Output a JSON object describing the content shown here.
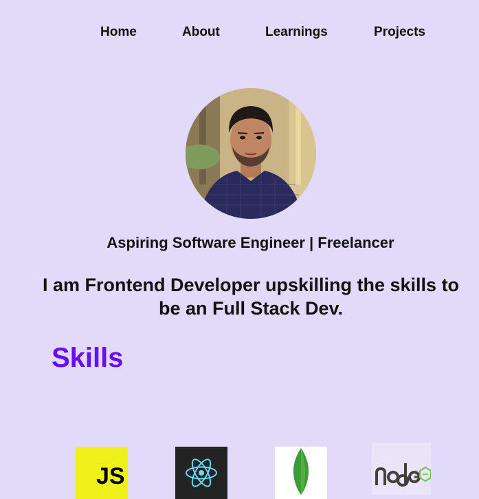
{
  "nav": {
    "items": [
      {
        "label": "Home"
      },
      {
        "label": "About"
      },
      {
        "label": "Learnings"
      },
      {
        "label": "Projects"
      }
    ]
  },
  "hero": {
    "avatar_icon": "profile-photo",
    "tagline": "Aspiring Software Engineer | Freelancer",
    "intro": "I am Frontend Developer upskilling the skills to be an Full Stack Dev."
  },
  "skills": {
    "heading": "Skills",
    "heading_color": "#6a0dfc",
    "items": [
      {
        "icon": "javascript-logo",
        "text": "JS"
      },
      {
        "icon": "react-logo"
      },
      {
        "icon": "mongodb-logo"
      },
      {
        "icon": "nodejs-logo"
      }
    ]
  },
  "colors": {
    "background": "#e3d9f8",
    "text": "#111111"
  }
}
